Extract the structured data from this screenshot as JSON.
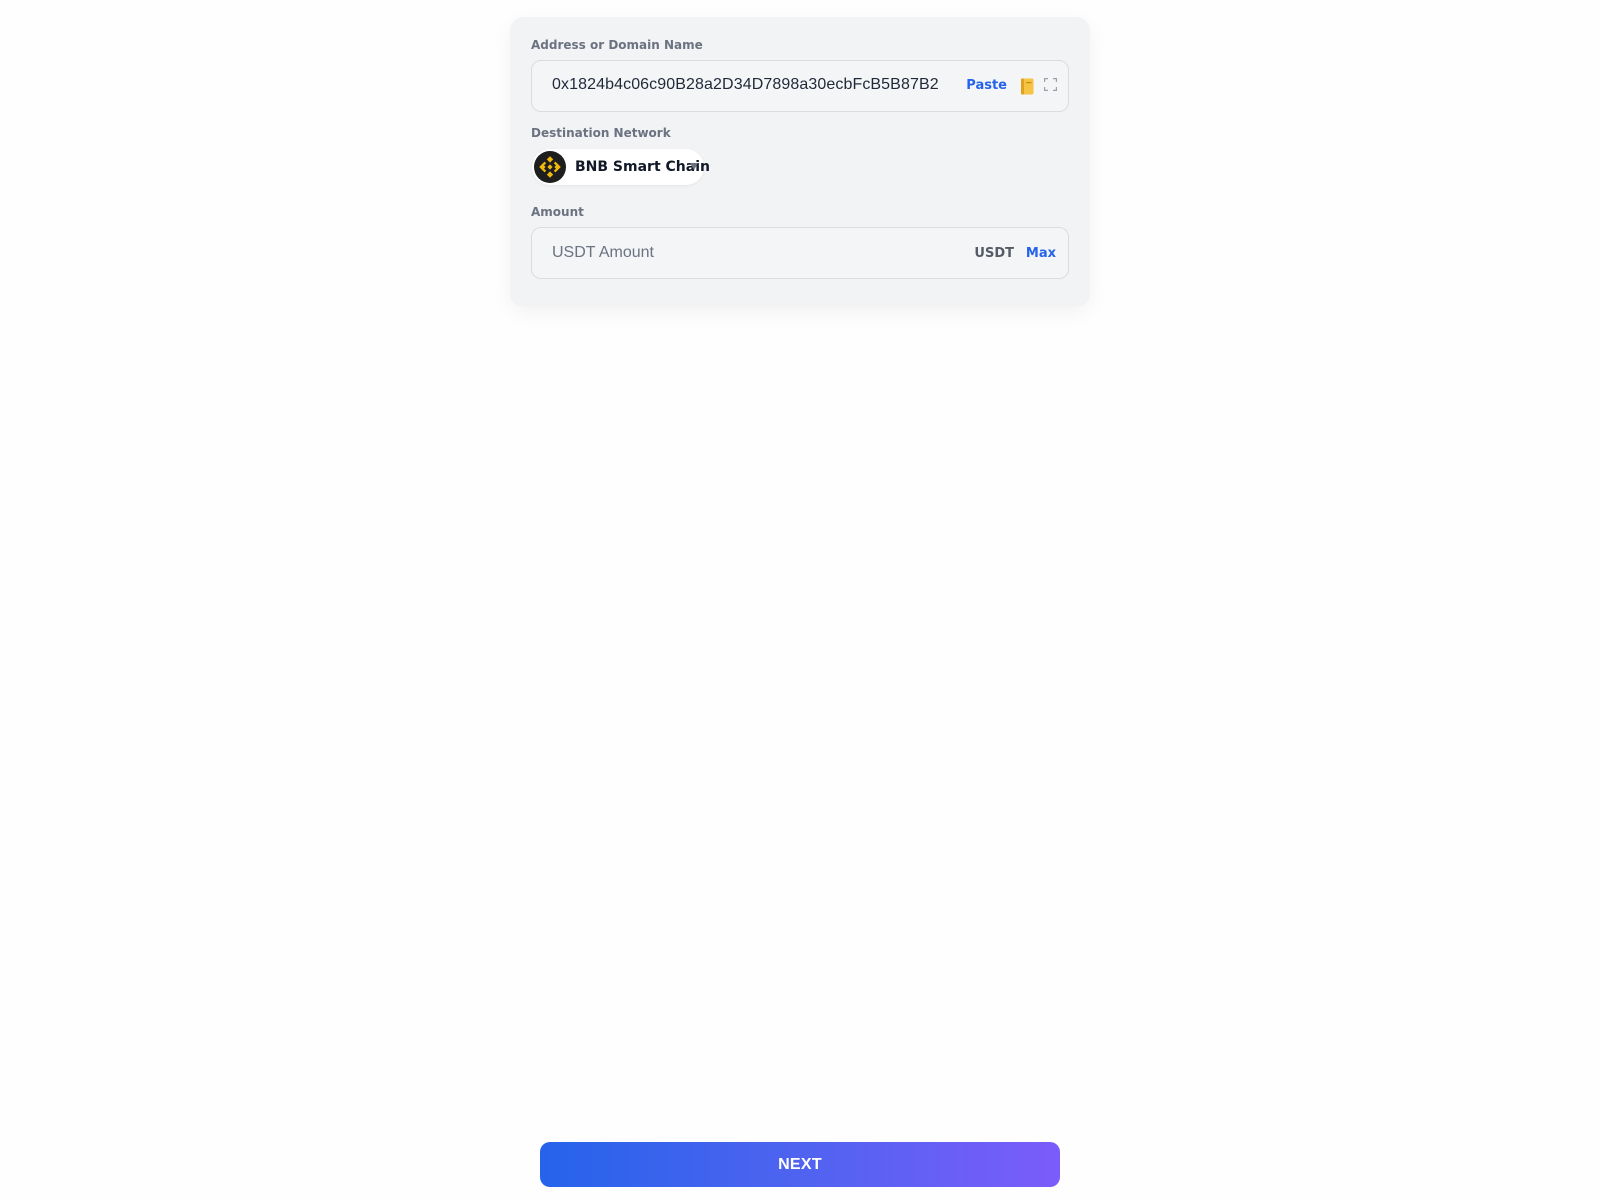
{
  "form": {
    "address": {
      "label": "Address or Domain Name",
      "value": "0x1824b4c06c90B28a2D34D7898a30ecbFcB5B87B2",
      "paste_label": "Paste",
      "address_book_icon": "address-book-icon",
      "scan_icon": "qr-scan-icon"
    },
    "network": {
      "label": "Destination Network",
      "selected": "BNB Smart Chain",
      "logo_icon": "bnb-logo-icon",
      "chevron_icon": "chevron-down-icon"
    },
    "amount": {
      "label": "Amount",
      "placeholder": "USDT Amount",
      "value": "",
      "currency": "USDT",
      "max_label": "Max"
    }
  },
  "footer": {
    "next_label": "NEXT"
  },
  "colors": {
    "accent": "#2563eb",
    "button_gradient_start": "#2563eb",
    "button_gradient_end": "#7b5cfa",
    "bnb_yellow": "#f0b90b",
    "card_background": "#f2f3f5"
  }
}
